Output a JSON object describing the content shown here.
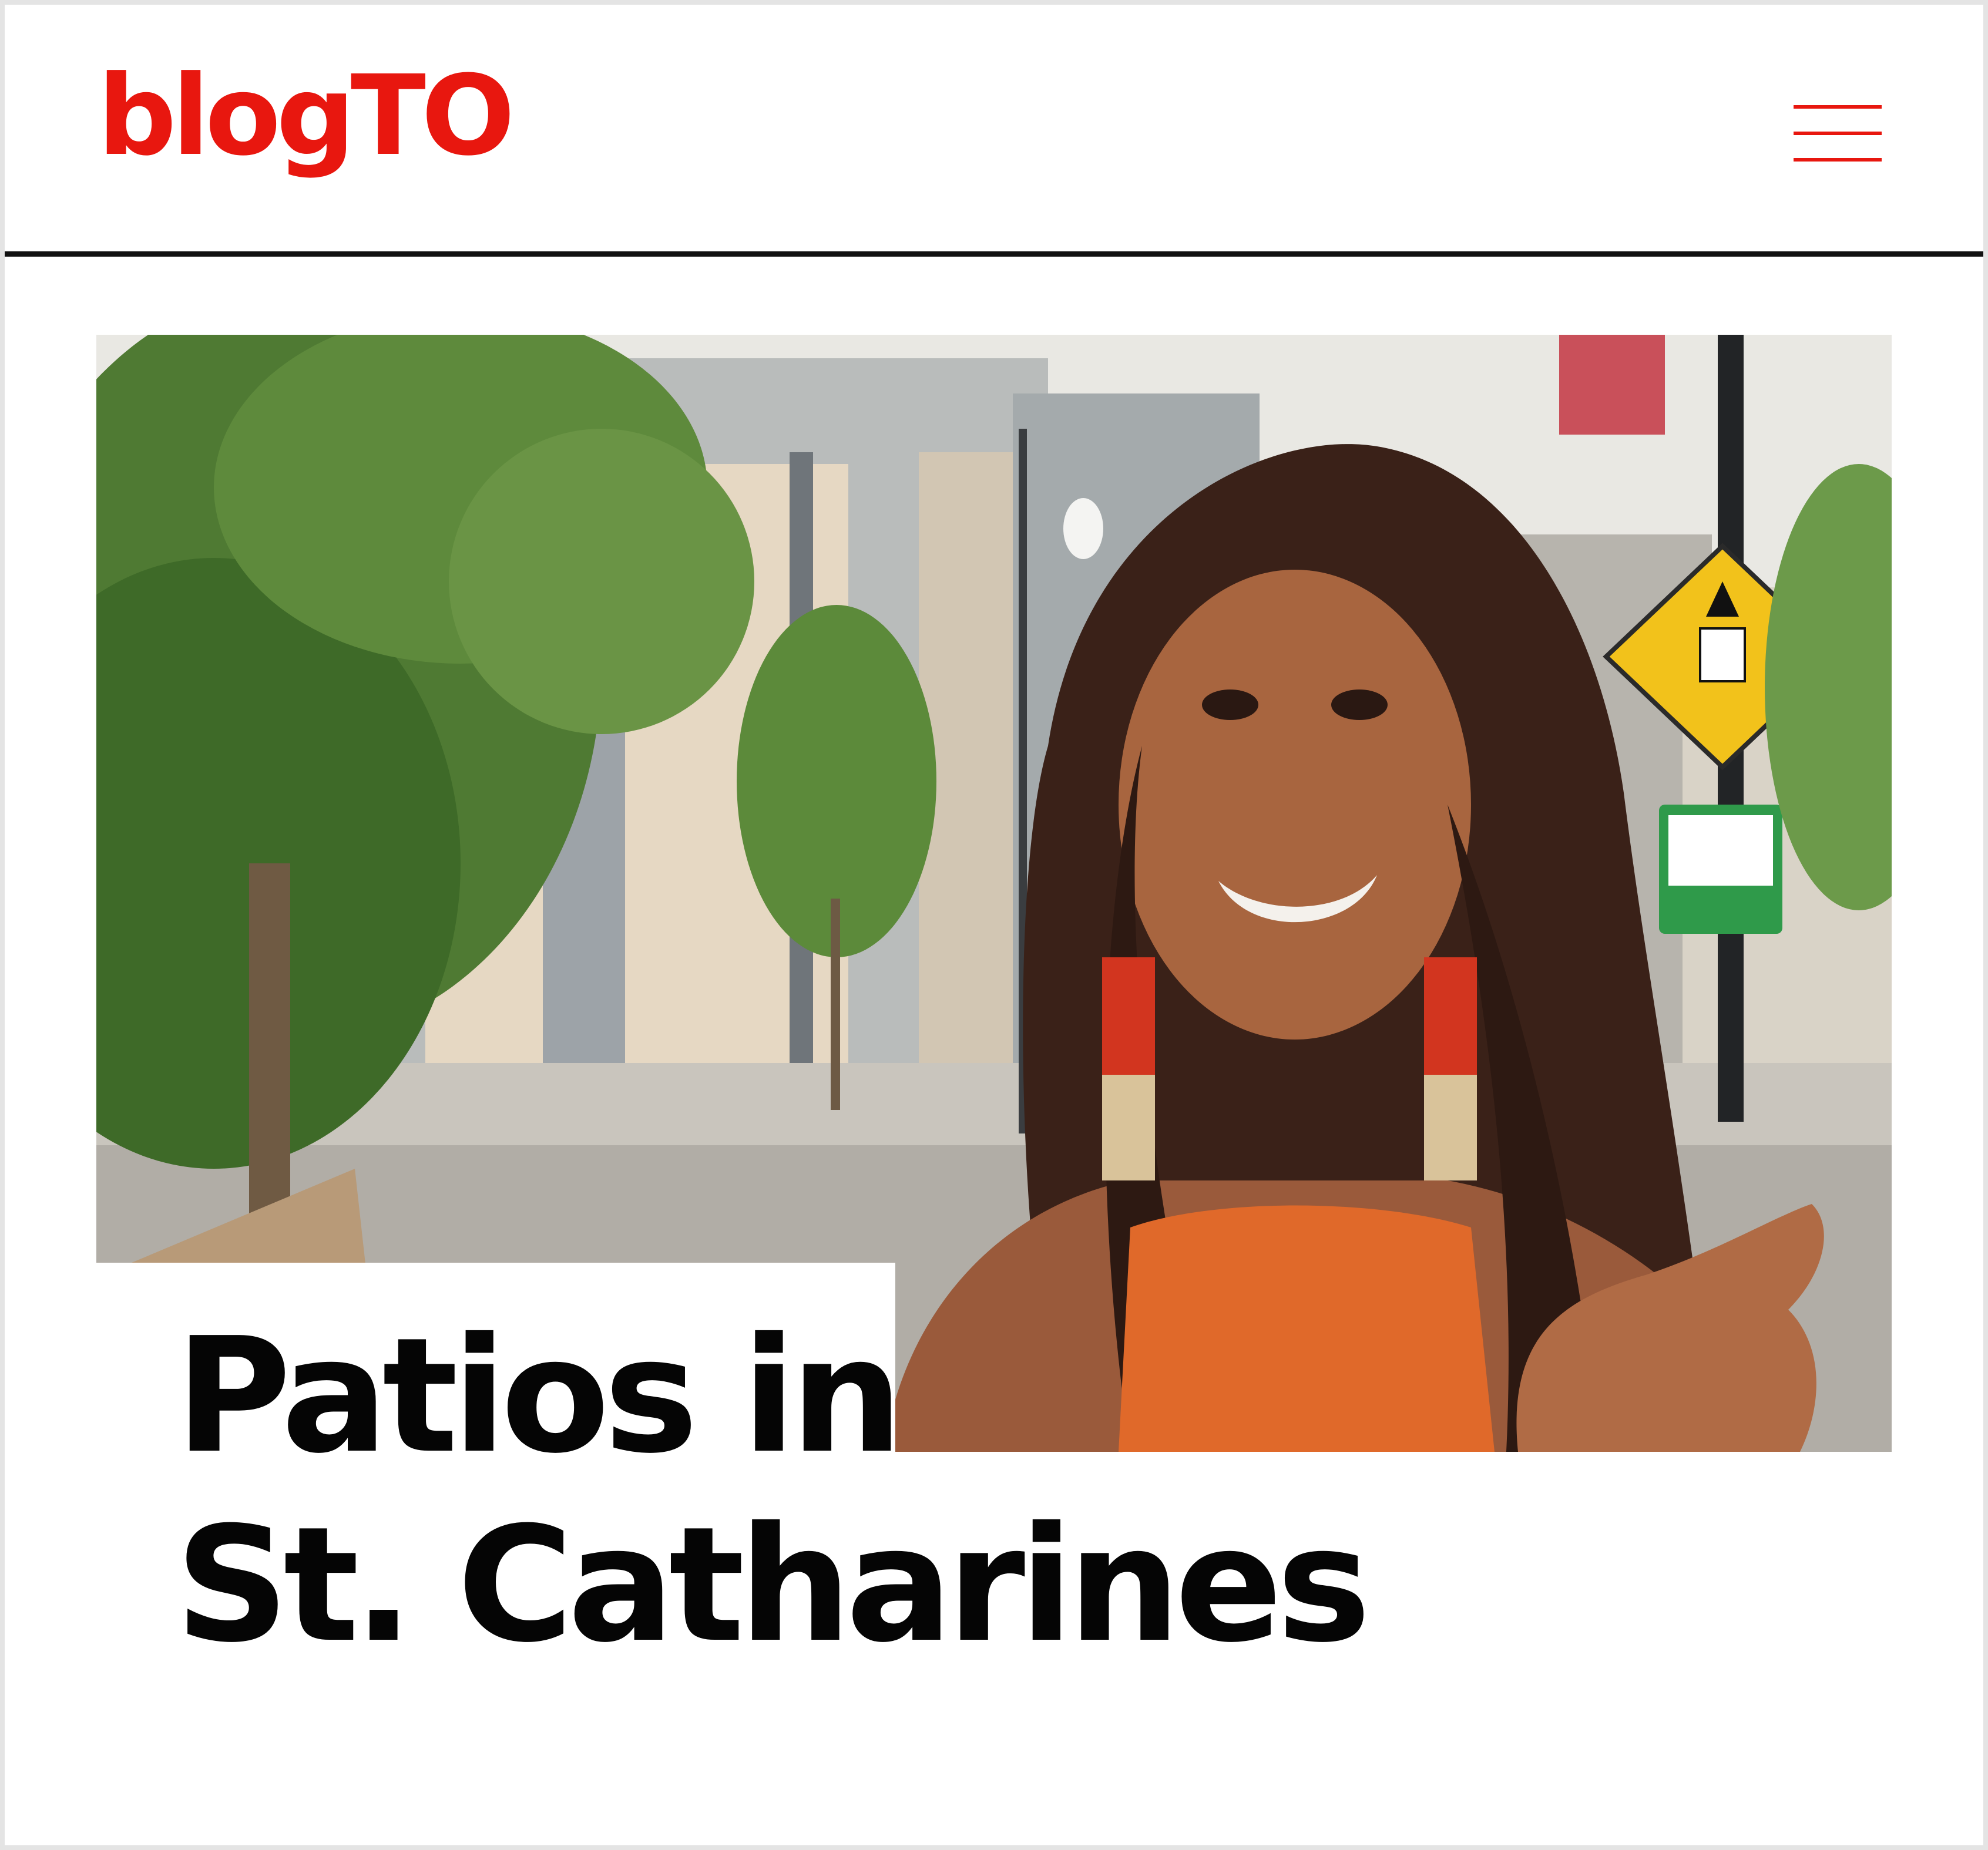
{
  "header": {
    "logo_text": "blogTO",
    "brand_color": "#e8170f",
    "menu_icon": "hamburger-menu-icon"
  },
  "article": {
    "title_line1": "Patios in",
    "title_line2": "St. Catharines",
    "hero_image_alt": "Woman with long dark hair, orange knit top and red-and-gold fringe earrings speaking to the camera on a downtown street with trees, modern buildings, a yellow pedestrian crossing sign and a green bike route sign"
  },
  "colors": {
    "background": "#ffffff",
    "header_rule": "#111111",
    "title": "#050505"
  }
}
